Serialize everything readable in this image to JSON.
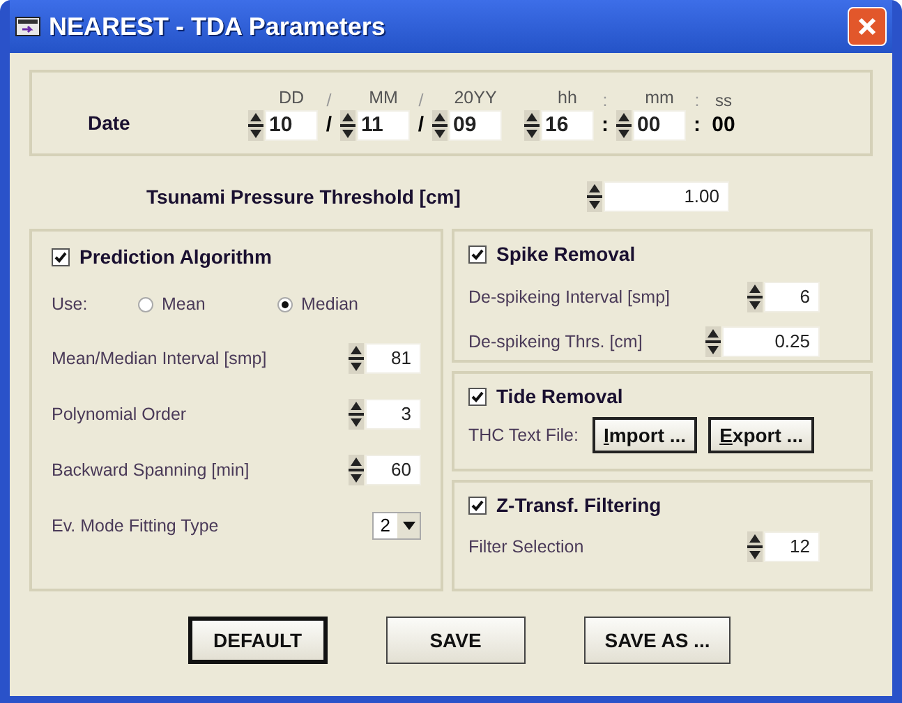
{
  "window": {
    "title": "NEAREST - TDA Parameters"
  },
  "date": {
    "label": "Date",
    "items": [
      {
        "kind": "field",
        "header": "DD",
        "value": "10"
      },
      {
        "kind": "separator",
        "header": "/",
        "value": "/"
      },
      {
        "kind": "field",
        "header": "MM",
        "value": "11"
      },
      {
        "kind": "separator",
        "header": "/",
        "value": "/"
      },
      {
        "kind": "field",
        "header": "20YY",
        "value": "09"
      },
      {
        "kind": "gap"
      },
      {
        "kind": "field",
        "header": "hh",
        "value": "16"
      },
      {
        "kind": "separator",
        "header": ":",
        "value": ":"
      },
      {
        "kind": "field",
        "header": "mm",
        "value": "00"
      },
      {
        "kind": "separator",
        "header": ":",
        "value": ":"
      },
      {
        "kind": "static",
        "header": "ss",
        "value": "00"
      }
    ]
  },
  "threshold": {
    "label": "Tsunami Pressure Threshold [cm]",
    "value": "1.00"
  },
  "prediction": {
    "title": "Prediction Algorithm",
    "checked": true,
    "use": {
      "label": "Use:",
      "options": [
        {
          "label": "Mean",
          "selected": false
        },
        {
          "label": "Median",
          "selected": true
        }
      ]
    },
    "rows": [
      {
        "kind": "spin",
        "label": "Mean/Median Interval [smp]",
        "value": "81"
      },
      {
        "kind": "spin",
        "label": "Polynomial Order",
        "value": "3"
      },
      {
        "kind": "spin",
        "label": "Backward Spanning [min]",
        "value": "60"
      },
      {
        "kind": "dropdown",
        "label": "Ev. Mode Fitting Type",
        "value": "2"
      }
    ]
  },
  "spike": {
    "title": "Spike Removal",
    "checked": true,
    "rows": [
      {
        "label": "De-spikeing Interval [smp]",
        "value": "6"
      },
      {
        "label": "De-spikeing Thrs. [cm]",
        "value": "0.25"
      }
    ]
  },
  "tide": {
    "title": "Tide Removal",
    "checked": true,
    "label": "THC Text File:",
    "buttons": [
      {
        "label": "Import ...",
        "first_letter_underlined": true
      },
      {
        "label": "Export ...",
        "first_letter_underlined": true
      }
    ]
  },
  "ztransf": {
    "title": "Z-Transf. Filtering",
    "checked": true,
    "rows": [
      {
        "label": "Filter Selection",
        "value": "12"
      }
    ]
  },
  "buttons": [
    {
      "label": "DEFAULT",
      "default": true
    },
    {
      "label": "SAVE",
      "default": false
    },
    {
      "label": "SAVE AS ...",
      "default": false
    }
  ]
}
